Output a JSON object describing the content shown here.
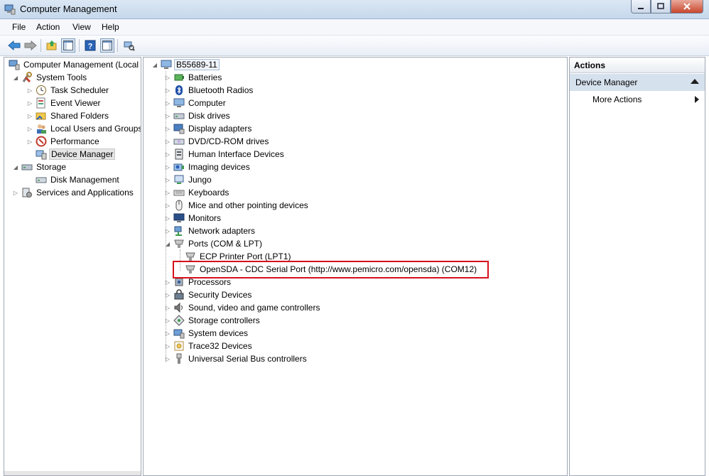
{
  "window": {
    "title": "Computer Management"
  },
  "menu": [
    "File",
    "Action",
    "View",
    "Help"
  ],
  "left_tree": {
    "root": "Computer Management (Local",
    "system_tools": "System Tools",
    "task_scheduler": "Task Scheduler",
    "event_viewer": "Event Viewer",
    "shared_folders": "Shared Folders",
    "local_users": "Local Users and Groups",
    "performance": "Performance",
    "device_manager": "Device Manager",
    "storage": "Storage",
    "disk_management": "Disk Management",
    "services": "Services and Applications"
  },
  "device_tree": {
    "host": "B55689-11",
    "categories": [
      {
        "label": "Batteries",
        "icon": "battery-icon"
      },
      {
        "label": "Bluetooth Radios",
        "icon": "bluetooth-icon"
      },
      {
        "label": "Computer",
        "icon": "computer-icon"
      },
      {
        "label": "Disk drives",
        "icon": "disk-drive-icon"
      },
      {
        "label": "Display adapters",
        "icon": "display-adapter-icon"
      },
      {
        "label": "DVD/CD-ROM drives",
        "icon": "dvd-drive-icon"
      },
      {
        "label": "Human Interface Devices",
        "icon": "hid-icon"
      },
      {
        "label": "Imaging devices",
        "icon": "imaging-device-icon"
      },
      {
        "label": "Jungo",
        "icon": "jungo-icon"
      },
      {
        "label": "Keyboards",
        "icon": "keyboard-icon"
      },
      {
        "label": "Mice and other pointing devices",
        "icon": "mouse-icon"
      },
      {
        "label": "Monitors",
        "icon": "monitor-icon"
      },
      {
        "label": "Network adapters",
        "icon": "network-adapter-icon"
      },
      {
        "label": "Ports (COM & LPT)",
        "icon": "port-icon"
      }
    ],
    "ports_children": [
      "ECP Printer Port (LPT1)",
      "OpenSDA - CDC Serial Port (http://www.pemicro.com/opensda) (COM12)"
    ],
    "categories_after": [
      {
        "label": "Processors",
        "icon": "processor-icon"
      },
      {
        "label": "Security Devices",
        "icon": "security-device-icon"
      },
      {
        "label": "Sound, video and game controllers",
        "icon": "sound-icon"
      },
      {
        "label": "Storage controllers",
        "icon": "storage-controller-icon"
      },
      {
        "label": "System devices",
        "icon": "system-device-icon"
      },
      {
        "label": "Trace32 Devices",
        "icon": "trace32-icon"
      },
      {
        "label": "Universal Serial Bus controllers",
        "icon": "usb-icon"
      }
    ]
  },
  "actions": {
    "title": "Actions",
    "section": "Device Manager",
    "more": "More Actions"
  },
  "colors": {
    "highlight_box": "#d6101a",
    "actions_section_bg": "#d6e1ee"
  }
}
